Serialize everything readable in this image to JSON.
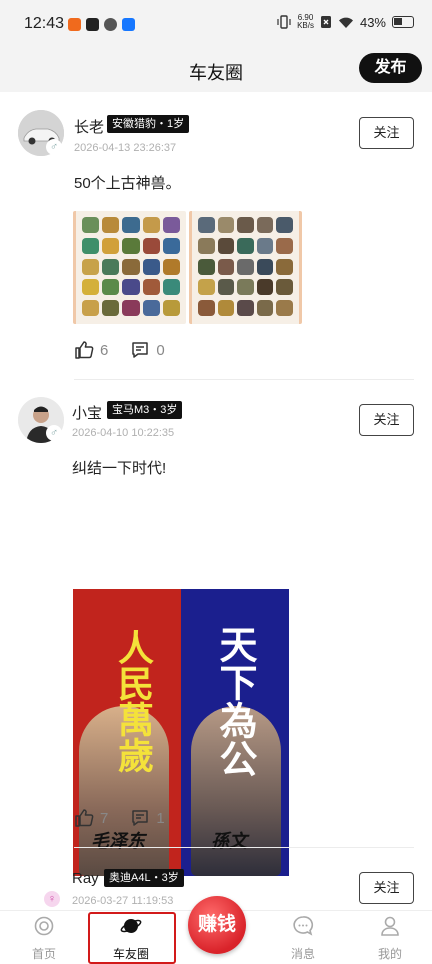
{
  "status_bar": {
    "time": "12:43",
    "net_speed_value": "6.90",
    "net_speed_unit": "KB/s",
    "battery": "43%"
  },
  "header": {
    "title": "车友圈",
    "publish_label": "发布"
  },
  "posts": [
    {
      "username": "长老",
      "car_tag": "安徽猎豹・1岁",
      "time": "2026-04-13 23:26:37",
      "follow_label": "关注",
      "text": "50个上古神兽。",
      "likes": "6",
      "comments": "0"
    },
    {
      "username": "小宝",
      "car_tag": "宝马M3・3岁",
      "time": "2026-04-10 10:22:35",
      "follow_label": "关注",
      "text": "纠结一下时代!",
      "poster_left_text": "人民萬歲",
      "poster_right_text": "天下為公",
      "poster_left_sign": "毛泽东",
      "poster_right_sign": "孫文",
      "likes": "7",
      "comments": "1"
    },
    {
      "username": "Ray",
      "car_tag": "奥迪A4L・3岁",
      "time": "2026-03-27 11:19:53",
      "follow_label": "关注"
    }
  ],
  "bottom_nav": {
    "items": [
      {
        "label": "首页",
        "icon": "home-icon"
      },
      {
        "label": "车友圈",
        "icon": "planet-icon"
      },
      {
        "label": "赚钱",
        "icon": "earn-icon"
      },
      {
        "label": "消息",
        "icon": "message-icon"
      },
      {
        "label": "我的",
        "icon": "profile-icon"
      }
    ]
  },
  "colors": {
    "accent_red": "#d9232a",
    "highlight_outline": "#d21a1a",
    "tag_bg": "#111111"
  }
}
